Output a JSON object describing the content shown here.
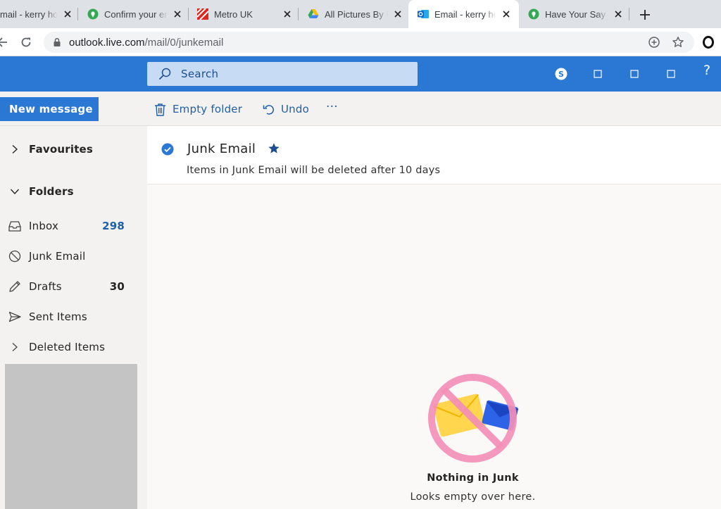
{
  "browser": {
    "tabs": [
      {
        "title": "mail - kerry ho",
        "active": false
      },
      {
        "title": "Confirm your email",
        "active": false
      },
      {
        "title": "Metro UK",
        "active": false
      },
      {
        "title": "All Pictures By Ke",
        "active": false
      },
      {
        "title": "Email - kerry ho",
        "active": true
      },
      {
        "title": "Have Your Say Tod",
        "active": false
      }
    ],
    "url_host": "outlook.live.com",
    "url_path": "/mail/0/junkemail"
  },
  "header": {
    "search_placeholder": "Search",
    "help_label": "?",
    "accent_color": "#2b77d4"
  },
  "commands": {
    "new_message": "New message",
    "empty_folder": "Empty folder",
    "undo": "Undo",
    "more": "···"
  },
  "nav": {
    "favourites": "Favourites",
    "folders": "Folders",
    "items": [
      {
        "label": "Inbox",
        "count": "298",
        "icon": "inbox-icon"
      },
      {
        "label": "Junk Email",
        "count": "",
        "icon": "blocked-icon"
      },
      {
        "label": "Drafts",
        "count": "30",
        "icon": "pencil-icon"
      },
      {
        "label": "Sent Items",
        "count": "",
        "icon": "send-icon"
      },
      {
        "label": "Deleted Items",
        "count": "",
        "icon": "chevron-right-icon"
      }
    ]
  },
  "folder": {
    "title": "Junk Email",
    "subtitle": "Items in Junk Email will be deleted after 10 days"
  },
  "empty_state": {
    "title": "Nothing in Junk",
    "subtitle": "Looks empty over here."
  }
}
